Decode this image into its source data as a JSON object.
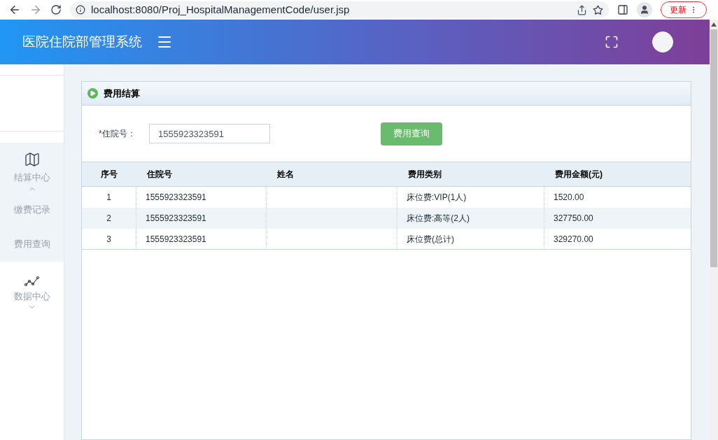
{
  "browser": {
    "url": "localhost:8080/Proj_HospitalManagementCode/user.jsp",
    "update_button": "更新"
  },
  "header": {
    "title": "医院住院部管理系统"
  },
  "sidebar": {
    "groups": [
      {
        "label": "结算中心",
        "kind": "map",
        "expanded": true,
        "children": [
          {
            "label": "缴费记录"
          },
          {
            "label": "费用查询"
          }
        ]
      },
      {
        "label": "数据中心",
        "kind": "chart",
        "expanded": false
      }
    ]
  },
  "panel": {
    "title": "费用结算",
    "form": {
      "label": "住院号：",
      "required_mark": "*",
      "value": "1555923323591",
      "button": "费用查询"
    },
    "table": {
      "columns": [
        "序号",
        "住院号",
        "姓名",
        "费用类别",
        "费用金额(元)"
      ],
      "rows": [
        [
          "1",
          "1555923323591",
          "",
          "床位费:VIP(1人)",
          "1520.00"
        ],
        [
          "2",
          "1555923323591",
          "",
          "床位费:高等(2人)",
          "327750.00"
        ],
        [
          "3",
          "1555923323591",
          "",
          "床位费(总计)",
          "329270.00"
        ]
      ]
    }
  }
}
